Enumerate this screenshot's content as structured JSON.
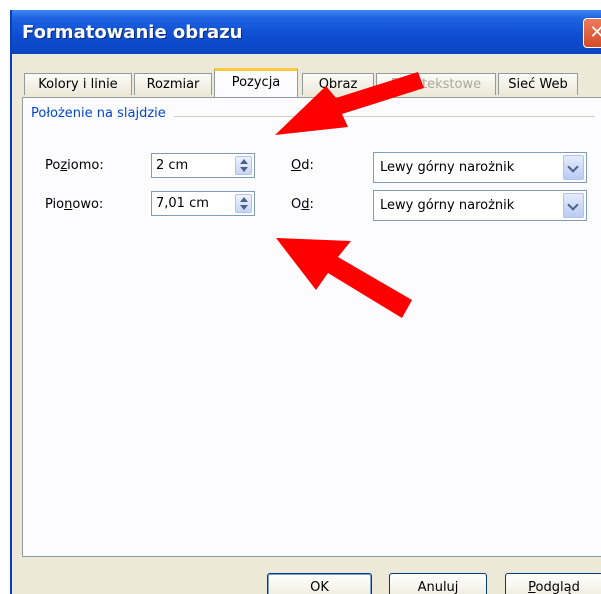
{
  "window": {
    "title": "Formatowanie obrazu",
    "close_icon": "close-icon",
    "title_color": "#0b45c2"
  },
  "tabs": [
    {
      "label": "Kolory i linie",
      "active": false,
      "disabled": false
    },
    {
      "label": "Rozmiar",
      "active": false,
      "disabled": false
    },
    {
      "label": "Pozycja",
      "active": true,
      "disabled": false
    },
    {
      "label": "Obraz",
      "active": false,
      "disabled": false
    },
    {
      "label": "Pole tekstowe",
      "active": false,
      "disabled": true
    },
    {
      "label": "Sieć Web",
      "active": false,
      "disabled": false
    }
  ],
  "position_group": {
    "title": "Położenie na slajdzie",
    "horizontal": {
      "label_pre": "Po",
      "label_u": "z",
      "label_post": "iomo:",
      "value": "2 cm",
      "from_label_u": "O",
      "from_label_post": "d:",
      "from_value": "Lewy górny narożnik"
    },
    "vertical": {
      "label_pre": "Pio",
      "label_u": "n",
      "label_post": "owo:",
      "value": "7,01 cm",
      "from_label_pre": "O",
      "from_label_u": "d",
      "from_label_post": ":",
      "from_value": "Lewy górny narożnik"
    }
  },
  "buttons": {
    "ok": "OK",
    "cancel": "Anuluj",
    "preview_u": "P",
    "preview_post": "odgląd"
  },
  "annotations": {
    "arrow_color": "#ff0000",
    "arrow_icon": "red-arrow-icon"
  }
}
